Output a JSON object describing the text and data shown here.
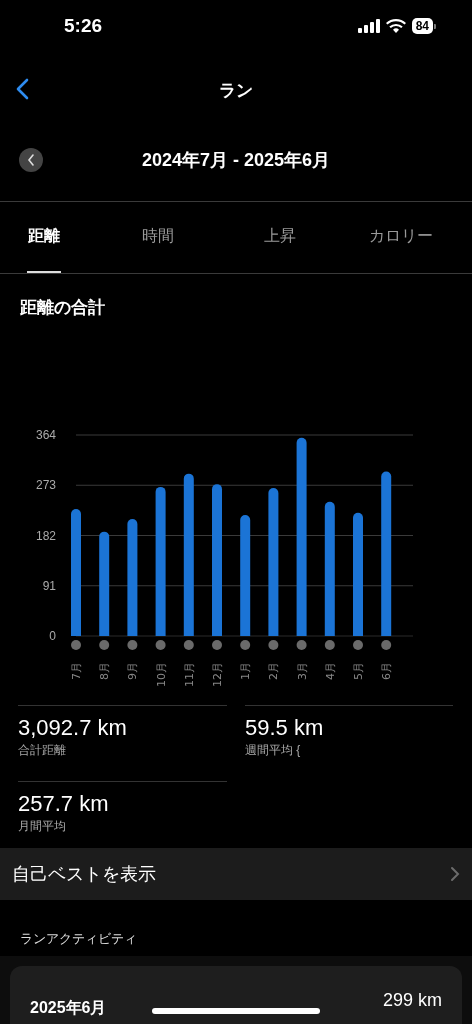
{
  "status_bar": {
    "time": "5:26",
    "battery": "84"
  },
  "nav": {
    "title": "ラン"
  },
  "period": {
    "label": "2024年7月 - 2025年6月"
  },
  "tabs": [
    {
      "label": "距離",
      "selected": true
    },
    {
      "label": "時間",
      "selected": false
    },
    {
      "label": "上昇",
      "selected": false
    },
    {
      "label": "カロリー",
      "selected": false
    }
  ],
  "section_title": "距離の合計",
  "chart": {
    "chart_data": {
      "type": "bar",
      "categories": [
        "7月",
        "8月",
        "9月",
        "10月",
        "11月",
        "12月",
        "1月",
        "2月",
        "3月",
        "4月",
        "5月",
        "6月"
      ],
      "grid": true,
      "series": [
        {
          "color": "#1b74d6",
          "values": [
            230,
            189,
            212,
            270,
            294,
            275,
            219,
            268,
            359,
            243,
            223,
            298
          ]
        }
      ],
      "ylim": [
        0,
        364
      ],
      "yticks": [
        0,
        91,
        182,
        273,
        364
      ]
    }
  },
  "stats": [
    {
      "value": "3,092.7 km",
      "label": "合計距離"
    },
    {
      "value": "59.5 km",
      "label": "週間平均 {"
    },
    {
      "value": "257.7 km",
      "label": "月間平均"
    }
  ],
  "personal_best": {
    "label": "自己ベストを表示"
  },
  "activity": {
    "title": "ランアクティビティ",
    "items": [
      {
        "month": "2025年6月",
        "distance": "299 km"
      }
    ]
  }
}
